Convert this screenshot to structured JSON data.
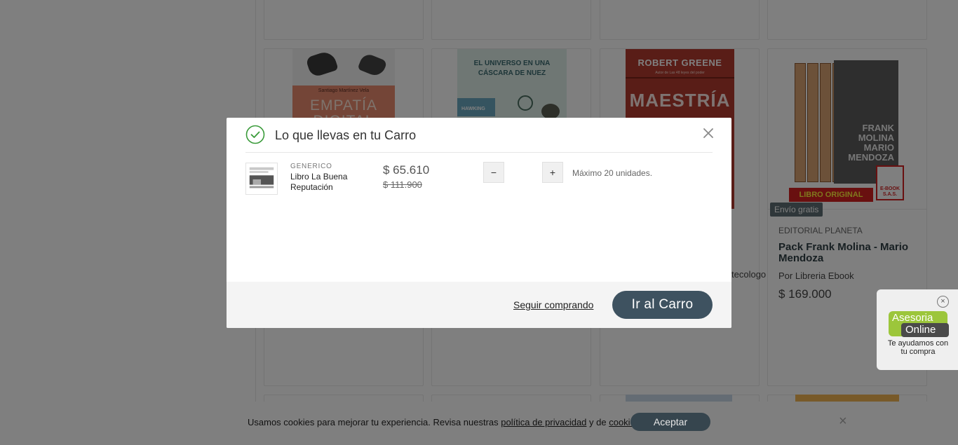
{
  "modal": {
    "title": "Lo que llevas en tu Carro",
    "item": {
      "brand": "GENERICO",
      "name": "Libro La Buena Reputación",
      "price": "$ 65.610",
      "old_price": "$ 111.900",
      "qty_minus": "−",
      "qty_plus": "+",
      "max_units": "Máximo 20 unidades."
    },
    "continue_link": "Seguir comprando",
    "cart_button": "Ir al Carro"
  },
  "background": {
    "covers": {
      "empatia": {
        "author": "Santiago Martínez Vela",
        "title": "EMPATÍA DIGITAL"
      },
      "hawking": {
        "title": "EL UNIVERSO EN UNA CÁSCARA DE NUEZ",
        "author": "HAWKING"
      },
      "greene": {
        "author": "ROBERT GREENE",
        "subtitle": "Autor de Las 48 leyes del poder",
        "title": "MAESTRÍA"
      },
      "pack": {
        "front": "FRANK MOLINA MARIO MENDOZA",
        "banner": "LIBRO ORIGINAL",
        "badge": "E-BOOK S.A.S."
      }
    },
    "product": {
      "badge": "Envío gratis",
      "brand": "EDITORIAL PLANETA",
      "title": "Pack Frank Molina - Mario Mendoza",
      "seller": "Por Libreria Ebook",
      "price": "$ 169.000"
    },
    "partial_seller": "tecologo"
  },
  "chat": {
    "line1": "Asesoria",
    "line2": "Online",
    "subtitle": "Te ayudamos con tu compra",
    "close": "×"
  },
  "cookies": {
    "text_before": "Usamos cookies para mejorar tu experiencia. Revisa nuestras ",
    "privacy_link": "política de privacidad",
    "text_middle": " y de ",
    "cookies_link": "cookies",
    "text_after": ".",
    "accept": "Aceptar",
    "close": "×"
  },
  "colors": {
    "primary_button": "#3e5260",
    "success_green": "#3a9b3a",
    "overlay": "rgba(0,0,0,0.5)"
  }
}
